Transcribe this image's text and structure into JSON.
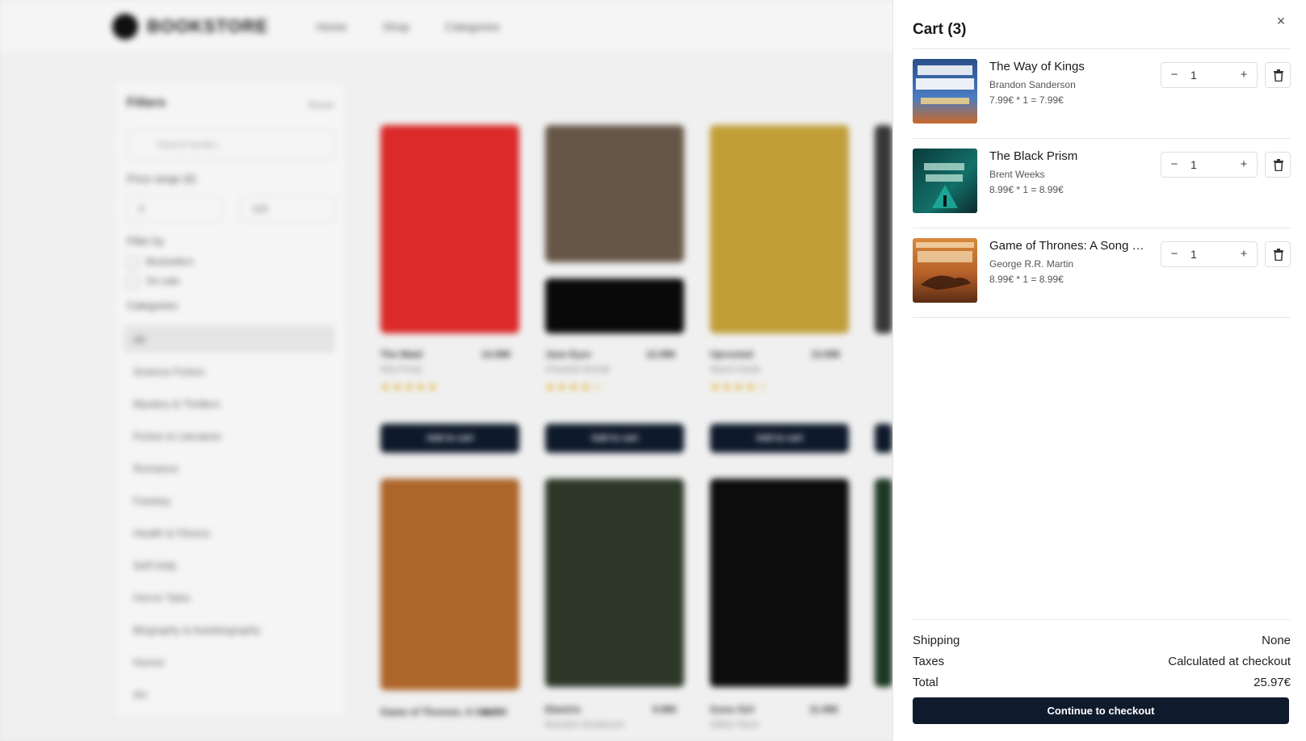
{
  "store": {
    "brand": "BOOKSTORE",
    "nav": [
      "Home",
      "Shop",
      "Categories"
    ],
    "filters": {
      "title": "Filters",
      "reset": "Reset",
      "search_placeholder": "Search books...",
      "price_label": "Price range (€)",
      "price_min": "0",
      "price_max": "100",
      "filter_by_label": "Filter by",
      "checks": [
        "Bestsellers",
        "On sale"
      ],
      "categories_label": "Categories",
      "categories": [
        "All",
        "Science Fiction",
        "Mystery & Thrillers",
        "Fiction & Literature",
        "Romance",
        "Fantasy",
        "Health & Fitness",
        "Self-Help",
        "Horror Tales",
        "Biography & Autobiography",
        "Humor",
        "Art"
      ]
    },
    "books": [
      {
        "title": "The Maid",
        "author": "Nita Prose",
        "price": "14.99€",
        "stars": "★★★★★",
        "button": "Add to cart"
      },
      {
        "title": "Jane Eyre",
        "author": "Charlotte Brontë",
        "price": "12.99€",
        "stars": "★★★★☆",
        "button": "Add to cart"
      },
      {
        "title": "Uprooted",
        "author": "Naomi Novik",
        "price": "13.99€",
        "stars": "★★★★☆",
        "button": "Add to cart"
      },
      {
        "title": "Game of Thrones: A Son...",
        "author": "George R.R. Martin",
        "price": "8.99€",
        "stars": "★★★★☆",
        "button": "Add to cart"
      },
      {
        "title": "Elantris",
        "author": "Brandon Sanderson",
        "price": "9.99€",
        "stars": "★★★★☆",
        "button": "Add to cart"
      },
      {
        "title": "Gone Girl",
        "author": "Gillian Flynn",
        "price": "11.99€",
        "stars": "★★★★☆",
        "button": "Add to cart"
      }
    ]
  },
  "cart": {
    "title": "Cart (3)",
    "items": [
      {
        "title": "The Way of Kings",
        "author": "Brandon Sanderson",
        "price_line": "7.99€ * 1 = 7.99€",
        "qty": "1",
        "minus": "−",
        "plus": "+"
      },
      {
        "title": "The Black Prism",
        "author": "Brent Weeks",
        "price_line": "8.99€ * 1 = 8.99€",
        "qty": "1",
        "minus": "−",
        "plus": "+"
      },
      {
        "title": "Game of Thrones: A Song of Ice and Fire",
        "author": "George R.R. Martin",
        "price_line": "8.99€ * 1 = 8.99€",
        "qty": "1",
        "minus": "−",
        "plus": "+"
      }
    ],
    "summary": {
      "shipping_label": "Shipping",
      "shipping_value": "None",
      "taxes_label": "Taxes",
      "taxes_value": "Calculated at checkout",
      "total_label": "Total",
      "total_value": "25.97€"
    },
    "checkout_label": "Continue to checkout",
    "close_icon": "×"
  },
  "colors": {
    "primary_button": "#0f1b2d",
    "star": "#e8b41f"
  }
}
